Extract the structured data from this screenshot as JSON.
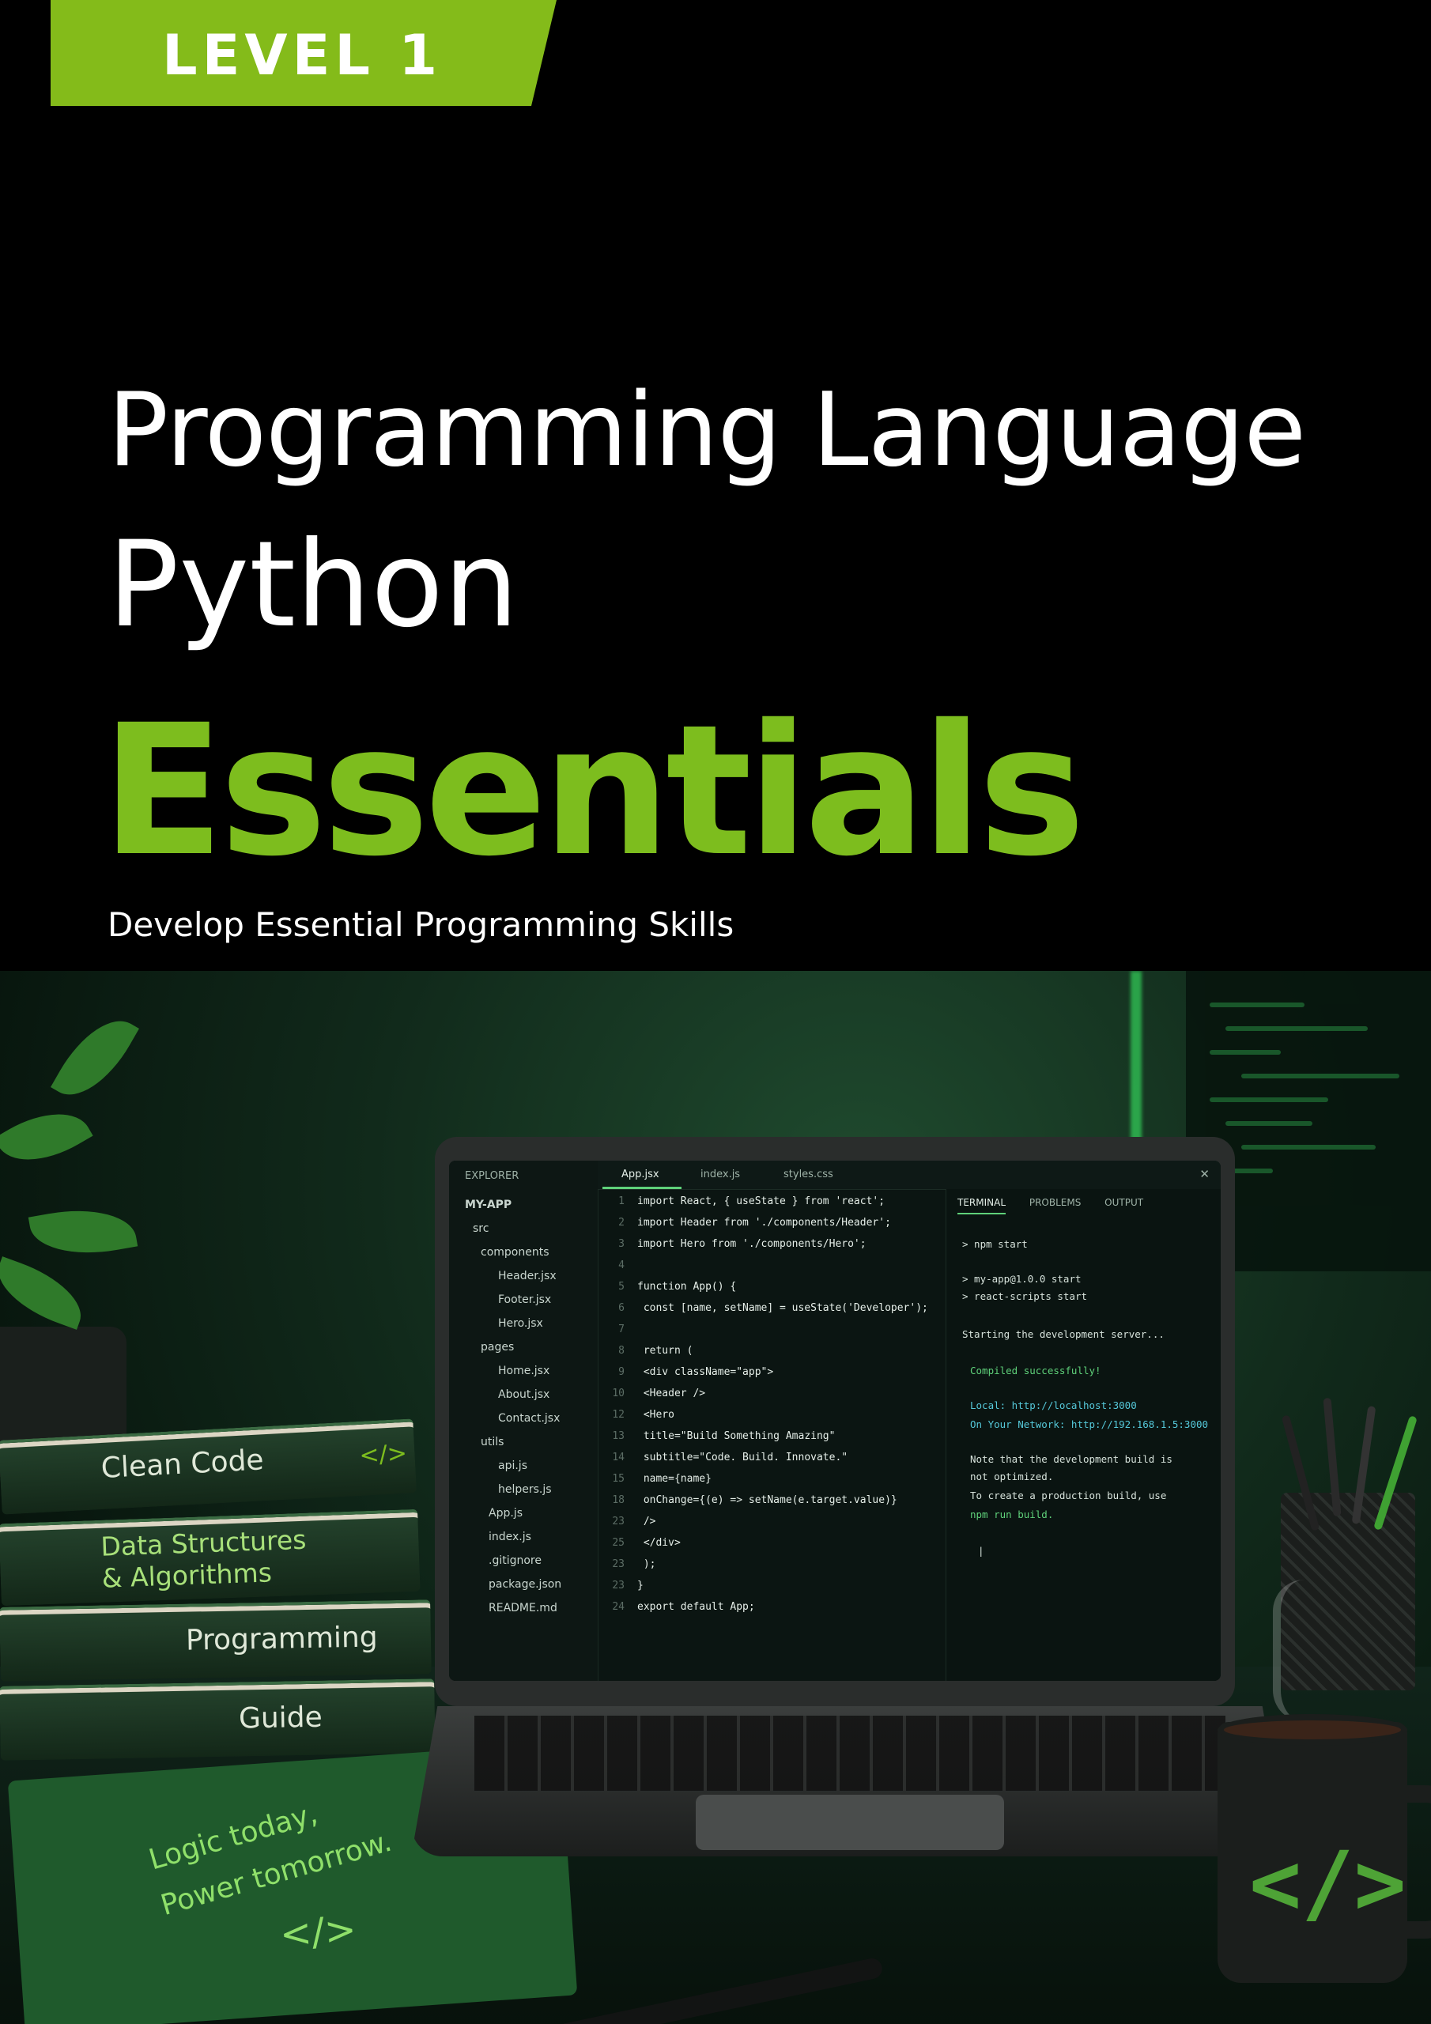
{
  "badge": {
    "label": "LEVEL 1"
  },
  "title": {
    "line1": "Programming Language",
    "line2": "Python",
    "line3": "Essentials",
    "subtitle": "Develop Essential Programming Skills"
  },
  "colors": {
    "accent": "#84bb1a",
    "accent_text": "#7dbd1e",
    "background": "#000000"
  },
  "books": [
    "Clean Code",
    "Data Structures",
    "& Algorithms",
    "Programming",
    "Guide"
  ],
  "book_icon": "</>",
  "notebook": {
    "line1": "Logic today,",
    "line2": "Power tomorrow.",
    "icon": "</>"
  },
  "mug_icon": "</>",
  "editor": {
    "explorer_title": "EXPLORER",
    "project": "MY-APP",
    "tree": [
      "src",
      "components",
      "Header.jsx",
      "Footer.jsx",
      "Hero.jsx",
      "pages",
      "Home.jsx",
      "About.jsx",
      "Contact.jsx",
      "utils",
      "api.js",
      "helpers.js",
      "App.js",
      "index.js",
      ".gitignore",
      "package.json",
      "README.md"
    ],
    "tabs": [
      "App.jsx",
      "index.js",
      "styles.css"
    ],
    "code": [
      {
        "n": "1",
        "t": "import React, { useState } from 'react';"
      },
      {
        "n": "2",
        "t": "import Header from './components/Header';"
      },
      {
        "n": "3",
        "t": "import Hero from './components/Hero';"
      },
      {
        "n": "4",
        "t": ""
      },
      {
        "n": "5",
        "t": "function App() {"
      },
      {
        "n": "6",
        "t": "  const [name, setName] = useState('Developer');"
      },
      {
        "n": "7",
        "t": ""
      },
      {
        "n": "8",
        "t": "  return ("
      },
      {
        "n": "9",
        "t": "    <div className=\"app\">"
      },
      {
        "n": "10",
        "t": "      <Header />"
      },
      {
        "n": "12",
        "t": "      <Hero"
      },
      {
        "n": "13",
        "t": "        title=\"Build Something Amazing\""
      },
      {
        "n": "14",
        "t": "        subtitle=\"Code. Build. Innovate.\""
      },
      {
        "n": "15",
        "t": "        name={name}"
      },
      {
        "n": "18",
        "t": "        onChange={(e) => setName(e.target.value)}"
      },
      {
        "n": "23",
        "t": "      />"
      },
      {
        "n": "25",
        "t": "    </div>"
      },
      {
        "n": "23",
        "t": "  );"
      },
      {
        "n": "23",
        "t": "}"
      },
      {
        "n": "24",
        "t": "export default App;"
      }
    ],
    "terminal_tabs": [
      "TERMINAL",
      "PROBLEMS",
      "OUTPUT"
    ],
    "terminal": [
      "> npm start",
      "> my-app@1.0.0 start",
      "> react-scripts start",
      "Starting the development server...",
      "Compiled successfully!",
      "Local:         http://localhost:3000",
      "On Your Network:  http://192.168.1.5:3000",
      "Note that the development build is",
      "not optimized.",
      "To create a production build, use",
      "npm run build.",
      "|"
    ]
  }
}
